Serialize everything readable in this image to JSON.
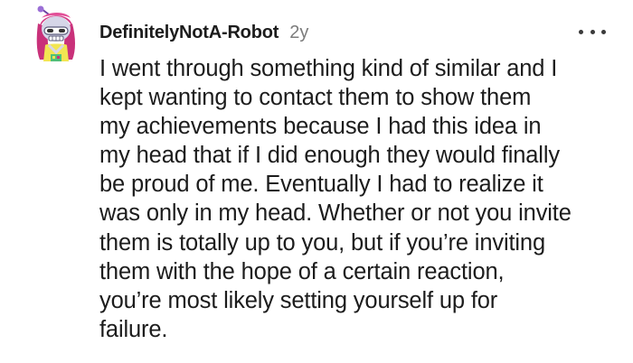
{
  "comment": {
    "avatar_icon": "reddit-snoo-avatar-icon",
    "username": "DefinitelyNotA-Robot",
    "age": "2y",
    "more_icon": "more-options-icon",
    "body_lines": [
      "I went through something kind of similar and I",
      "kept wanting to contact them to show them",
      "my achievements because I had this idea in",
      "my head that if I did enough they would finally",
      "be proud of me. Eventually I had to realize it",
      "was only in my head. Whether or not you invite",
      "them is totally up to you, but if you’re inviting",
      "them with the hope of a certain reaction,",
      "you’re most likely setting yourself up for",
      "failure."
    ]
  },
  "colors": {
    "text": "#1c1c1c",
    "meta": "#7c7c7c",
    "avatar_hair": "#c9317a",
    "avatar_face": "#d6d6e8",
    "avatar_shirt": "#f2e552"
  }
}
